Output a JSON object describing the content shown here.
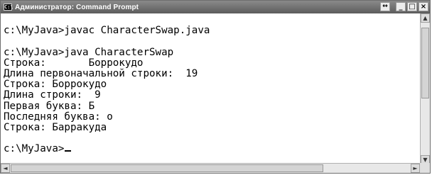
{
  "window": {
    "title": "Администратор: Command Prompt",
    "app_icon": "C:\\",
    "buttons": {
      "resize": "↔",
      "minimize": "_",
      "maximize": "□",
      "close": "×"
    }
  },
  "console": {
    "lines": [
      "",
      "c:\\MyJava>javac CharacterSwap.java",
      "",
      "c:\\MyJava>java CharacterSwap",
      "Строка:       Боррокудо",
      "Длина первоначальной строки:  19",
      "Строка: Боррокудо",
      "Длина строки:  9",
      "Первая буква: Б",
      "Последняя буква: о",
      "Строка: Барракуда",
      "",
      "c:\\MyJava>"
    ]
  },
  "scrollbars": {
    "up": "▲",
    "down": "▼",
    "left": "◄",
    "right": "►"
  },
  "colors": {
    "titlebar": "#6e6e6e",
    "console_bg": "#ffffff",
    "console_text": "#000000"
  }
}
